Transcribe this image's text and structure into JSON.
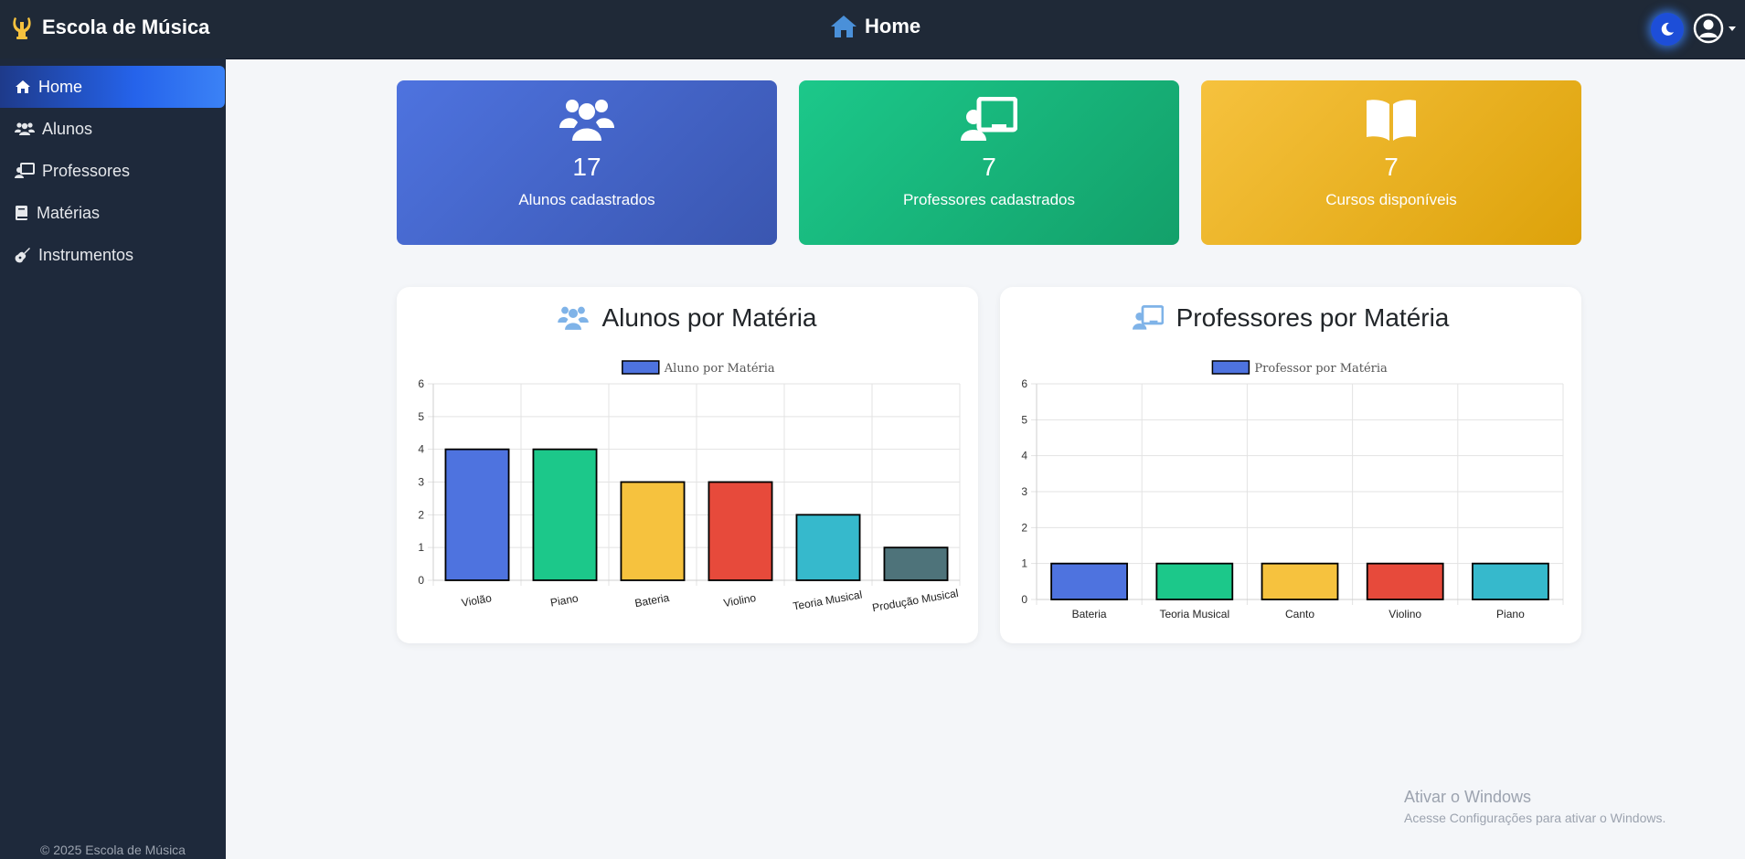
{
  "app": {
    "title": "Escola de Música",
    "page_title": "Home"
  },
  "sidebar": {
    "items": [
      {
        "label": "Home",
        "icon": "home-icon",
        "active": true
      },
      {
        "label": "Alunos",
        "icon": "users-icon"
      },
      {
        "label": "Professores",
        "icon": "chalkboard-teacher-icon"
      },
      {
        "label": "Matérias",
        "icon": "book-icon"
      },
      {
        "label": "Instrumentos",
        "icon": "guitar-icon"
      }
    ],
    "footer": "© 2025 Escola de Música"
  },
  "cards": [
    {
      "count": "17",
      "label": "Alunos cadastrados",
      "icon": "users-icon",
      "color": "#4e73df"
    },
    {
      "count": "7",
      "label": "Professores cadastrados",
      "icon": "chalkboard-teacher-icon",
      "color": "#1cc88a"
    },
    {
      "count": "7",
      "label": "Cursos disponíveis",
      "icon": "book-open-icon",
      "color": "#f6c23e"
    }
  ],
  "panels": {
    "alunos": {
      "title": "Alunos por Matéria"
    },
    "professores": {
      "title": "Professores por Matéria"
    }
  },
  "chart_data": [
    {
      "type": "bar",
      "legend": "Aluno por Matéria",
      "categories": [
        "Violão",
        "Piano",
        "Bateria",
        "Violino",
        "Teoria Musical",
        "Produção Musical"
      ],
      "values": [
        4,
        4,
        3,
        3,
        2,
        1
      ],
      "colors": [
        "#4e73df",
        "#1cc88a",
        "#f6c23e",
        "#e74a3b",
        "#36b9cc",
        "#4e737a"
      ],
      "ylim": [
        0,
        6
      ],
      "yticks": [
        "0",
        "1",
        "2",
        "3",
        "4",
        "5",
        "6"
      ],
      "grid": true,
      "legend_position": "top"
    },
    {
      "type": "bar",
      "legend": "Professor por Matéria",
      "categories": [
        "Bateria",
        "Teoria Musical",
        "Canto",
        "Violino",
        "Piano"
      ],
      "values": [
        1,
        1,
        1,
        1,
        1
      ],
      "colors": [
        "#4e73df",
        "#1cc88a",
        "#f6c23e",
        "#e74a3b",
        "#36b9cc"
      ],
      "ylim": [
        0,
        6
      ],
      "yticks": [
        "0",
        "1",
        "2",
        "3",
        "4",
        "5",
        "6"
      ],
      "grid": true,
      "legend_position": "top"
    }
  ],
  "watermark": {
    "title": "Ativar o Windows",
    "subtitle": "Acesse Configurações para ativar o Windows."
  }
}
